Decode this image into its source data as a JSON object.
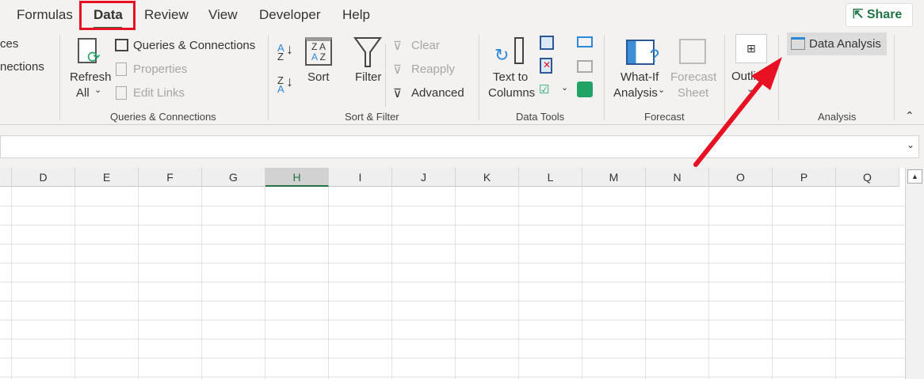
{
  "tabs": [
    "Formulas",
    "Data",
    "Review",
    "View",
    "Developer",
    "Help"
  ],
  "active_tab": "Data",
  "share_label": "Share",
  "left_partial": [
    "ces",
    "nections"
  ],
  "queries": {
    "refresh": "Refresh",
    "all": "All",
    "queries_connections": "Queries & Connections",
    "properties": "Properties",
    "edit_links": "Edit Links",
    "group": "Queries & Connections"
  },
  "sort_filter": {
    "sort": "Sort",
    "filter": "Filter",
    "clear": "Clear",
    "reapply": "Reapply",
    "advanced": "Advanced",
    "group": "Sort & Filter"
  },
  "data_tools": {
    "text_to": "Text to",
    "columns": "Columns",
    "group": "Data Tools"
  },
  "forecast": {
    "whatif": "What-If",
    "analysis": "Analysis",
    "forecast": "Forecast",
    "sheet": "Sheet",
    "group": "Forecast"
  },
  "outline": {
    "label": "Outline"
  },
  "analysis": {
    "data_analysis": "Data Analysis",
    "group": "Analysis"
  },
  "columns": [
    "D",
    "E",
    "F",
    "G",
    "H",
    "I",
    "J",
    "K",
    "L",
    "M",
    "N",
    "O",
    "P",
    "Q"
  ],
  "selected_column": "H",
  "colors": {
    "accent": "#217346",
    "highlight": "#e81123"
  }
}
